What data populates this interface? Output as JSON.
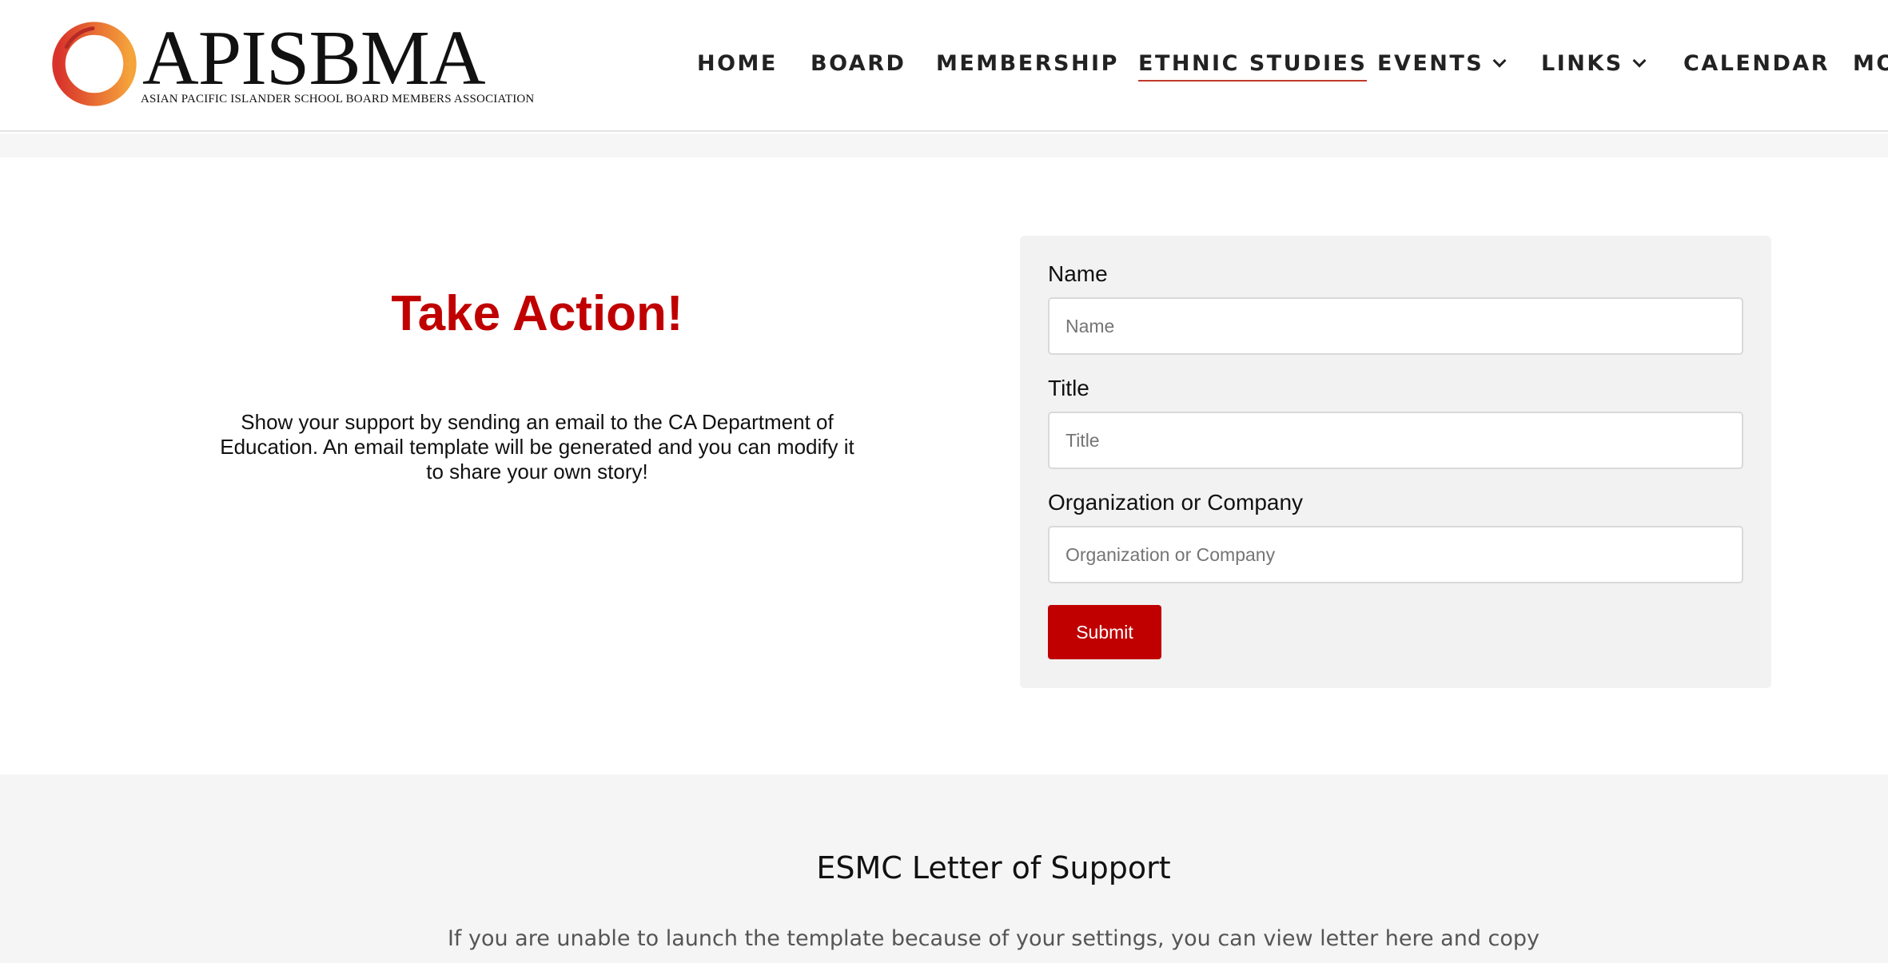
{
  "header": {
    "logo": {
      "wordmark": "APISBMA",
      "tagline": "ASIAN PACIFIC ISLANDER SCHOOL BOARD MEMBERS ASSOCIATION"
    },
    "nav": [
      {
        "label": "HOME"
      },
      {
        "label": "BOARD"
      },
      {
        "label": "MEMBERSHIP"
      },
      {
        "label": "ETHNIC STUDIES",
        "active": true
      },
      {
        "label": "EVENTS",
        "dropdown": true
      },
      {
        "label": "LINKS",
        "dropdown": true
      },
      {
        "label": "CALENDAR"
      },
      {
        "label": "MO"
      }
    ]
  },
  "action": {
    "heading": "Take Action!",
    "description": "Show your support by sending an email to the CA Department of Education. An email template will be generated and you can modify it to share your own story!"
  },
  "form": {
    "fields": [
      {
        "label": "Name",
        "placeholder": "Name"
      },
      {
        "label": "Title",
        "placeholder": "Title"
      },
      {
        "label": "Organization or Company",
        "placeholder": "Organization or Company"
      }
    ],
    "submit_label": "Submit"
  },
  "letter": {
    "title": "ESMC Letter of Support",
    "body": "If you are unable to  launch the template because of your settings, you can view letter here and copy"
  },
  "colors": {
    "accent": "#c00000",
    "logo_ring_start": "#d9342b",
    "logo_ring_end": "#f5a33b",
    "active_underline": "#c0392b"
  }
}
